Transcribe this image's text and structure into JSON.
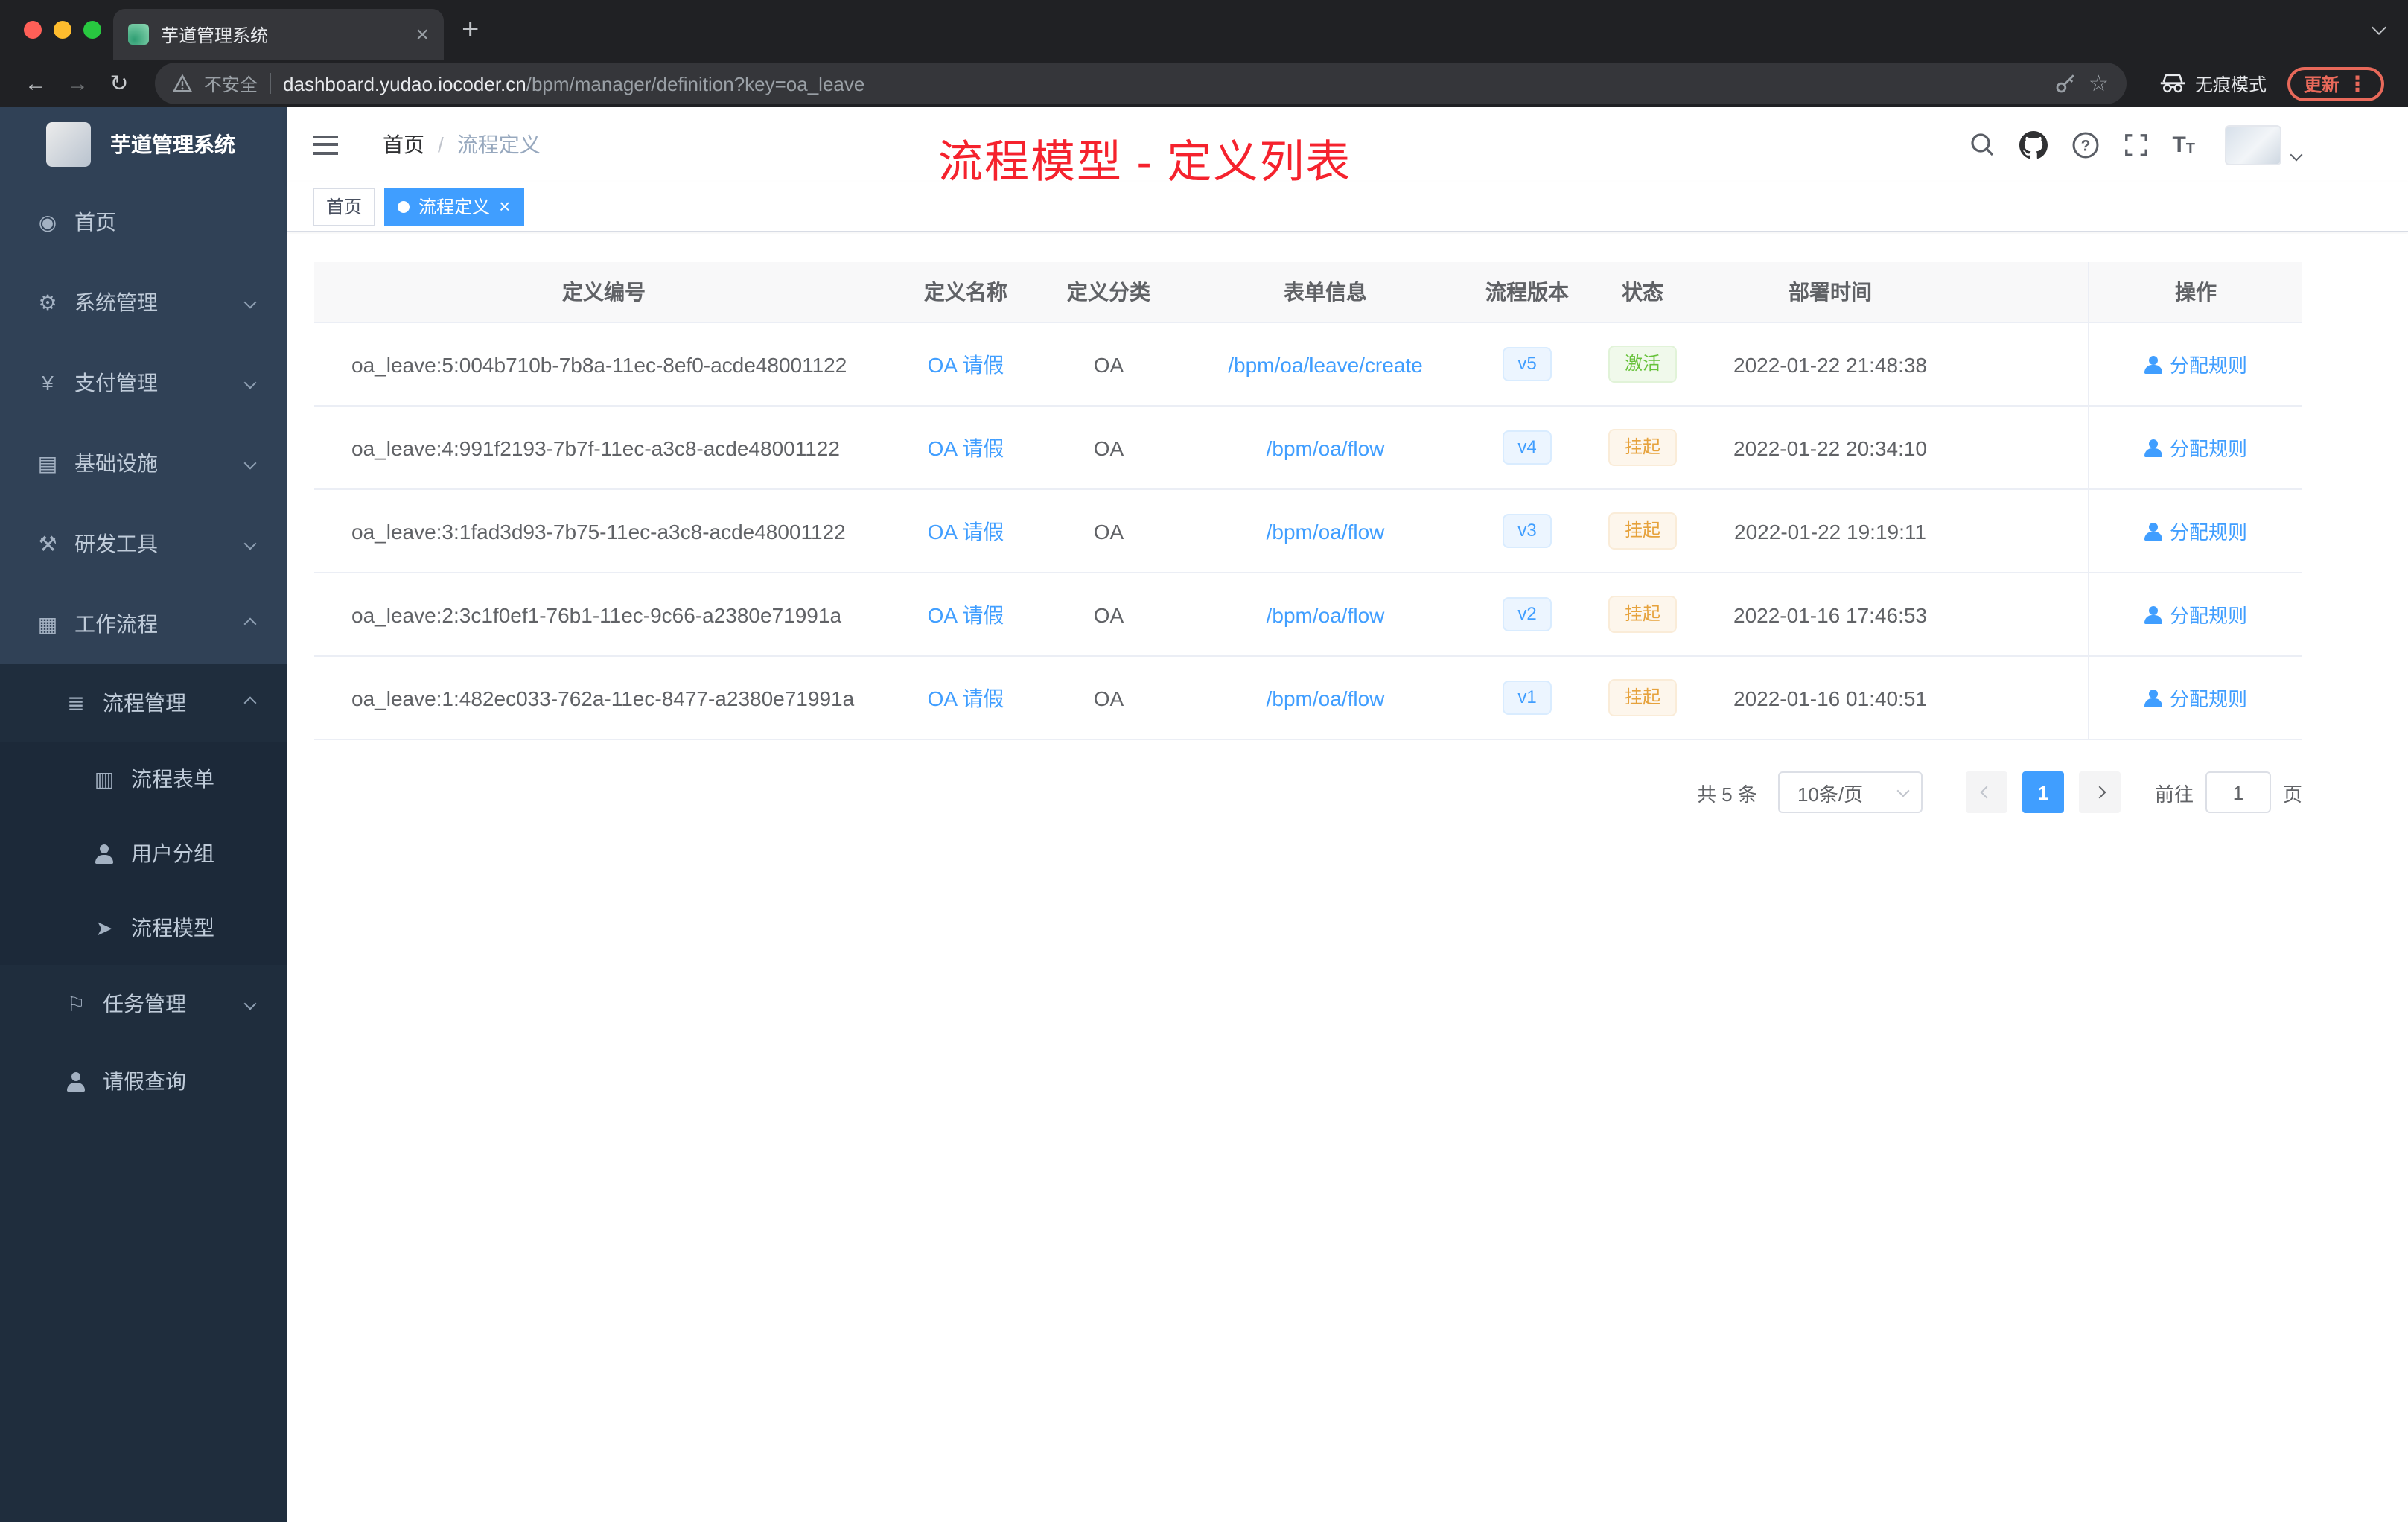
{
  "browser": {
    "tab_title": "芋道管理系统",
    "security_label": "不安全",
    "url_host": "dashboard.yudao.iocoder.cn",
    "url_path": "/bpm/manager/definition?key=oa_leave",
    "incognito_label": "无痕模式",
    "update_label": "更新"
  },
  "sidebar": {
    "app_title": "芋道管理系统",
    "menu": [
      {
        "name": "home",
        "icon": "home-icon",
        "label": "首页"
      },
      {
        "name": "system-management",
        "icon": "settings-icon",
        "label": "系统管理",
        "expand": false
      },
      {
        "name": "payment-management",
        "icon": "payment-icon",
        "label": "支付管理",
        "expand": false
      },
      {
        "name": "infrastructure",
        "icon": "infrastructure-icon",
        "label": "基础设施",
        "expand": false
      },
      {
        "name": "devtools",
        "icon": "devtools-icon",
        "label": "研发工具",
        "expand": false
      },
      {
        "name": "workflow",
        "icon": "workflow-icon",
        "label": "工作流程",
        "expand": true,
        "children": [
          {
            "name": "process-management",
            "icon": "process-management-icon",
            "label": "流程管理",
            "expand": true,
            "children": [
              {
                "name": "process-form",
                "icon": "process-form-icon",
                "label": "流程表单"
              },
              {
                "name": "user-group",
                "icon": "user-group-icon",
                "label": "用户分组"
              },
              {
                "name": "process-model",
                "icon": "process-model-icon",
                "label": "流程模型"
              }
            ]
          },
          {
            "name": "task-management",
            "icon": "task-management-icon",
            "label": "任务管理",
            "expand": false
          },
          {
            "name": "leave-query",
            "icon": "leave-query-icon",
            "label": "请假查询"
          }
        ]
      }
    ]
  },
  "navbar": {
    "breadcrumb": {
      "home": "首页",
      "separator": "/",
      "current": "流程定义"
    },
    "annotation": "流程模型 - 定义列表"
  },
  "tags": [
    {
      "label": "首页",
      "active": false
    },
    {
      "label": "流程定义",
      "active": true
    }
  ],
  "table": {
    "columns": [
      "定义编号",
      "定义名称",
      "定义分类",
      "表单信息",
      "流程版本",
      "状态",
      "部署时间",
      "操作"
    ],
    "rows": [
      {
        "id": "oa_leave:5:004b710b-7b8a-11ec-8ef0-acde48001122",
        "name": "OA 请假",
        "category": "OA",
        "form": "/bpm/oa/leave/create",
        "version": "v5",
        "status": "激活",
        "status_type": "success",
        "deployed_at": "2022-01-22 21:48:38",
        "action": "分配规则"
      },
      {
        "id": "oa_leave:4:991f2193-7b7f-11ec-a3c8-acde48001122",
        "name": "OA 请假",
        "category": "OA",
        "form": "/bpm/oa/flow",
        "version": "v4",
        "status": "挂起",
        "status_type": "warning",
        "deployed_at": "2022-01-22 20:34:10",
        "action": "分配规则"
      },
      {
        "id": "oa_leave:3:1fad3d93-7b75-11ec-a3c8-acde48001122",
        "name": "OA 请假",
        "category": "OA",
        "form": "/bpm/oa/flow",
        "version": "v3",
        "status": "挂起",
        "status_type": "warning",
        "deployed_at": "2022-01-22 19:19:11",
        "action": "分配规则"
      },
      {
        "id": "oa_leave:2:3c1f0ef1-76b1-11ec-9c66-a2380e71991a",
        "name": "OA 请假",
        "category": "OA",
        "form": "/bpm/oa/flow",
        "version": "v2",
        "status": "挂起",
        "status_type": "warning",
        "deployed_at": "2022-01-16 17:46:53",
        "action": "分配规则"
      },
      {
        "id": "oa_leave:1:482ec033-762a-11ec-8477-a2380e71991a",
        "name": "OA 请假",
        "category": "OA",
        "form": "/bpm/oa/flow",
        "version": "v1",
        "status": "挂起",
        "status_type": "warning",
        "deployed_at": "2022-01-16 01:40:51",
        "action": "分配规则"
      }
    ]
  },
  "pagination": {
    "total": "共 5 条",
    "page_size": "10条/页",
    "current_page": "1",
    "goto_label": "前往",
    "goto_value": "1",
    "page_unit": "页"
  },
  "colors": {
    "accent": "#409eff",
    "annotation_red": "#f5222d",
    "success": "#67c23a",
    "warning": "#e6a23c",
    "sidebar_bg": "#304156",
    "submenu_bg": "#1f2d3d"
  }
}
